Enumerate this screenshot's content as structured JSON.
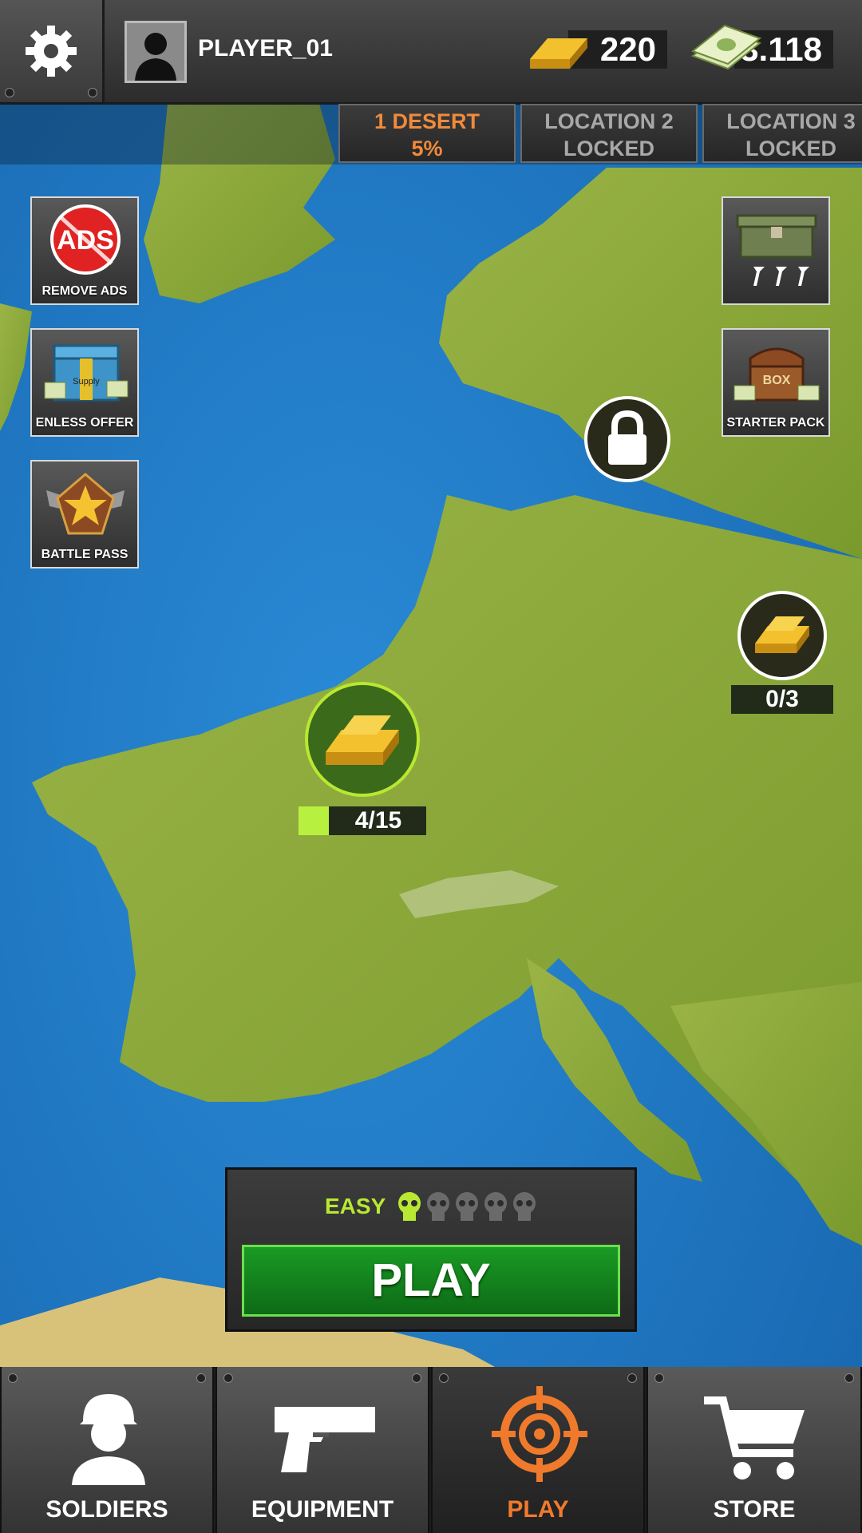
{
  "player": {
    "name": "PLAYER_01"
  },
  "currency": {
    "gold": "220",
    "cash": "3.118"
  },
  "locations": [
    {
      "line1": "1 DESERT",
      "line2": "5%"
    },
    {
      "line1": "LOCATION 2",
      "line2": "LOCKED"
    },
    {
      "line1": "LOCATION 3",
      "line2": "LOCKED"
    }
  ],
  "side_left": [
    {
      "label": "REMOVE ADS",
      "icon_text": "ADS"
    },
    {
      "label": "ENLESS OFFER",
      "icon_text": "Supply"
    },
    {
      "label": "BATTLE PASS"
    }
  ],
  "side_right": [
    {
      "label": ""
    },
    {
      "label": "STARTER PACK",
      "icon_text": "BOX"
    }
  ],
  "map_markers": {
    "gold_main_progress": "4/15",
    "gold_main_fraction": 0.27,
    "gold_east_progress": "0/3"
  },
  "play_panel": {
    "difficulty": "EASY",
    "difficulty_level": 1,
    "difficulty_max": 5,
    "play_label": "PLAY"
  },
  "nav": [
    {
      "label": "SOLDIERS",
      "icon": "soldier-icon"
    },
    {
      "label": "EQUIPMENT",
      "icon": "pistol-icon"
    },
    {
      "label": "PLAY",
      "icon": "crosshair-icon"
    },
    {
      "label": "STORE",
      "icon": "cart-icon"
    }
  ],
  "colors": {
    "sea": "#1e78c4",
    "land": "#8ea63a",
    "accent_orange": "#f07a2c",
    "accent_green": "#b8e832",
    "play_green": "#159a22"
  }
}
